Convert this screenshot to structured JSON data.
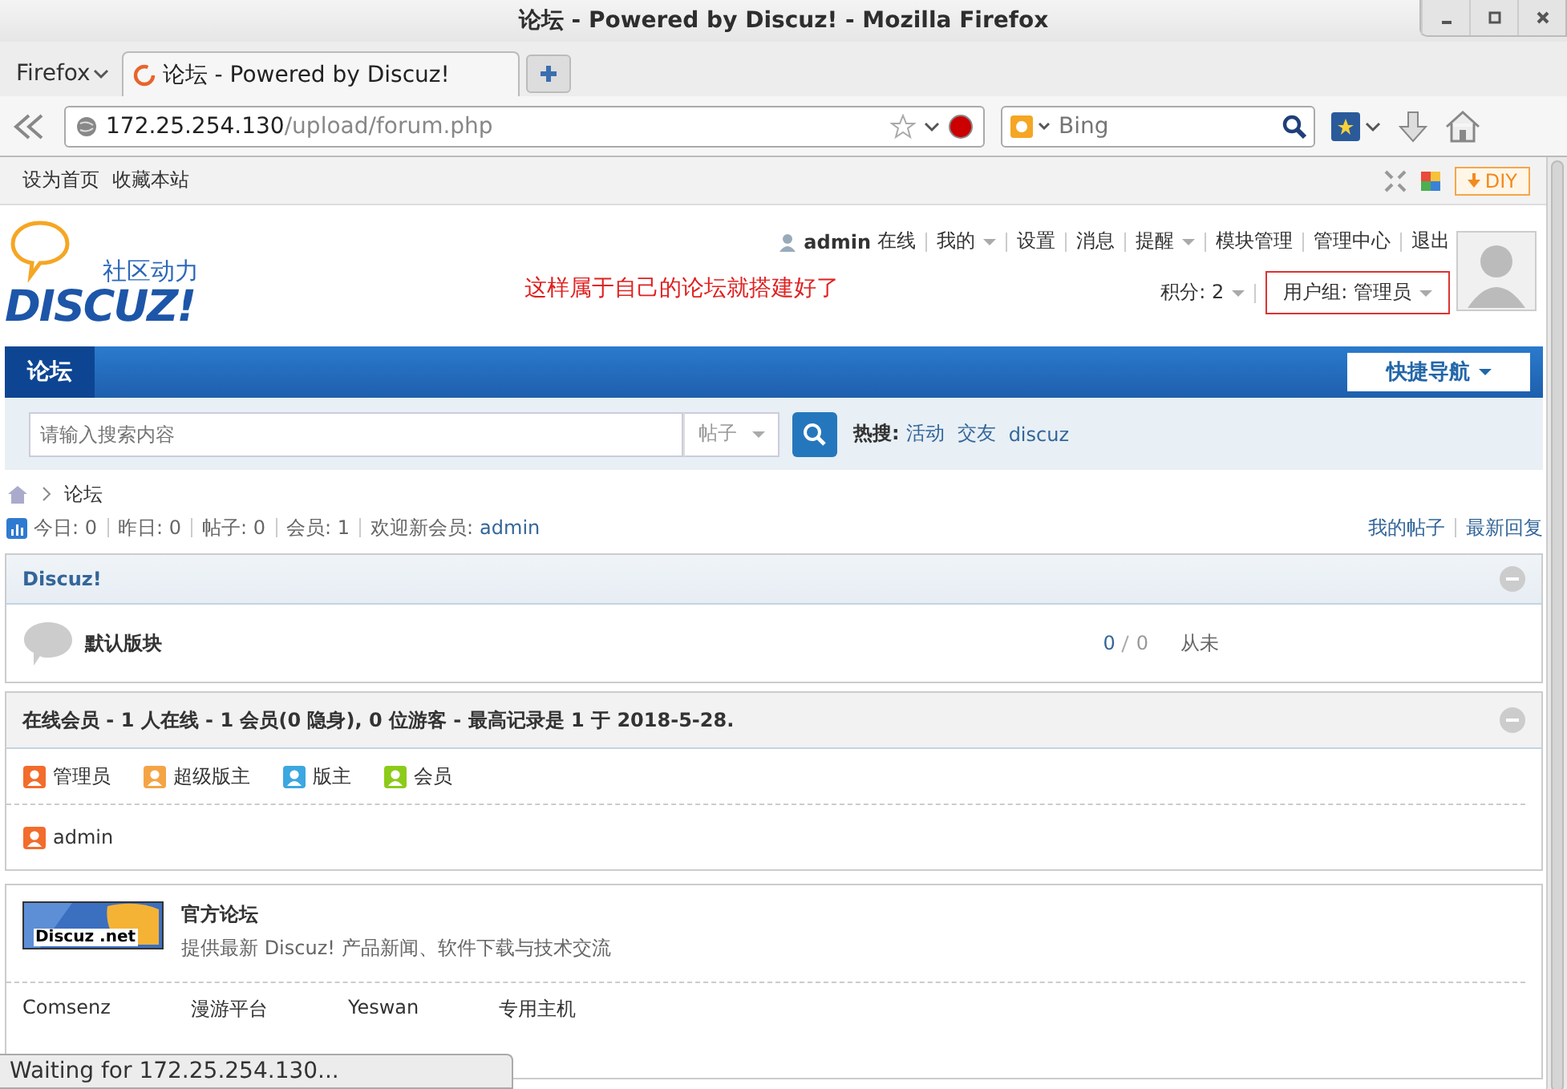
{
  "window": {
    "title": "论坛 - Powered by Discuz! - Mozilla Firefox"
  },
  "browser": {
    "menu_button": "Firefox",
    "tabs": [
      {
        "label": "论坛 - Powered by Discuz!",
        "selected": true
      }
    ],
    "address": {
      "host": "172.25.254.130",
      "path": "/upload/forum.php"
    },
    "search": {
      "placeholder": "Bing"
    }
  },
  "topbar": {
    "links": [
      "设为首页",
      "收藏本站"
    ],
    "diy_button": "DIY"
  },
  "header": {
    "logo_slogan": "社区动力",
    "logo_text": "DISCUZ!",
    "user": {
      "name": "admin",
      "status": "在线"
    },
    "menu": [
      {
        "label": "我的",
        "dropdown": true
      },
      {
        "label": "设置",
        "dropdown": false
      },
      {
        "label": "消息",
        "dropdown": false
      },
      {
        "label": "提醒",
        "dropdown": true
      },
      {
        "label": "模块管理",
        "dropdown": false
      },
      {
        "label": "管理中心",
        "dropdown": false
      },
      {
        "label": "退出",
        "dropdown": false
      }
    ],
    "credits": "积分: 2",
    "usergroup": "用户组: 管理员",
    "annotation": "这样属于自己的论坛就搭建好了"
  },
  "nav": {
    "items": [
      {
        "label": "论坛",
        "selected": true
      }
    ],
    "quick_nav": "快捷导航"
  },
  "searchbar": {
    "placeholder": "请输入搜索内容",
    "type": "帖子",
    "hot_label": "热搜:",
    "hot": [
      "活动",
      "交友",
      "discuz"
    ]
  },
  "breadcrumb": [
    "论坛"
  ],
  "stats": {
    "items": [
      "今日: 0",
      "昨日: 0",
      "帖子: 0",
      "会员: 1"
    ],
    "welcome": "欢迎新会员:",
    "newest": "admin",
    "links": [
      "我的帖子",
      "最新回复"
    ]
  },
  "category": {
    "title": "Discuz!",
    "forums": [
      {
        "name": "默认版块",
        "threads": "0",
        "posts": "0",
        "last": "从未"
      }
    ]
  },
  "online": {
    "title": "在线会员 - 1 人在线 - 1 会员(0 隐身), 0 位游客 - 最高记录是 1 于 2018-5-28.",
    "legend": [
      {
        "label": "管理员",
        "color": "#f26c2c"
      },
      {
        "label": "超级版主",
        "color": "#f5a445"
      },
      {
        "label": "版主",
        "color": "#3ca7e0"
      },
      {
        "label": "会员",
        "color": "#8ccb1a"
      }
    ],
    "users": [
      {
        "name": "admin",
        "color": "#f26c2c"
      }
    ]
  },
  "friendlinks": {
    "featured": {
      "logo": "Discuz .net",
      "name": "官方论坛",
      "description": "提供最新 Discuz! 产品新闻、软件下载与技术交流"
    },
    "links": [
      "Comsenz",
      "漫游平台",
      "Yeswan",
      "专用主机"
    ]
  },
  "status_bar": "Waiting for 172.25.254.130..."
}
